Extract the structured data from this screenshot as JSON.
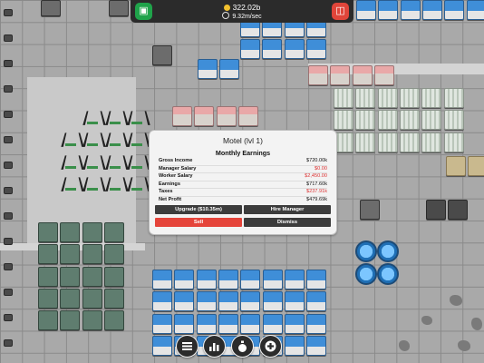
{
  "hud": {
    "money": "322.02b",
    "rate": "9.32m/sec",
    "left_icon": "city-manager-icon",
    "right_icon": "shop-icon",
    "coin_icon": "coin-icon",
    "clock_icon": "clock-icon"
  },
  "dialog": {
    "title": "Motel (lvl 1)",
    "subtitle": "Monthly Earnings",
    "rows": [
      {
        "label": "Gross Income",
        "value": "$720.00k",
        "negative": false
      },
      {
        "label": "Manager Salary",
        "value": "$0.00",
        "negative": true
      },
      {
        "label": "Worker Salary",
        "value": "$2,450.00",
        "negative": true
      },
      {
        "label": "Earnings",
        "value": "$717.60k",
        "negative": false
      },
      {
        "label": "Taxes",
        "value": "$237.91k",
        "negative": true
      },
      {
        "label": "Net Profit",
        "value": "$479.69k",
        "negative": false
      }
    ],
    "buttons": {
      "upgrade": "Upgrade ($10.35m)",
      "hire": "Hire Manager",
      "sell": "Sell",
      "dismiss": "Dismiss"
    }
  },
  "toolbar": {
    "items": [
      "menu-icon",
      "stats-icon",
      "money-bag-icon",
      "add-icon"
    ]
  },
  "colors": {
    "hud_bg": "#2b2b2b",
    "green": "#1fa34a",
    "red": "#e0453a",
    "negative_text": "#dd3333"
  }
}
